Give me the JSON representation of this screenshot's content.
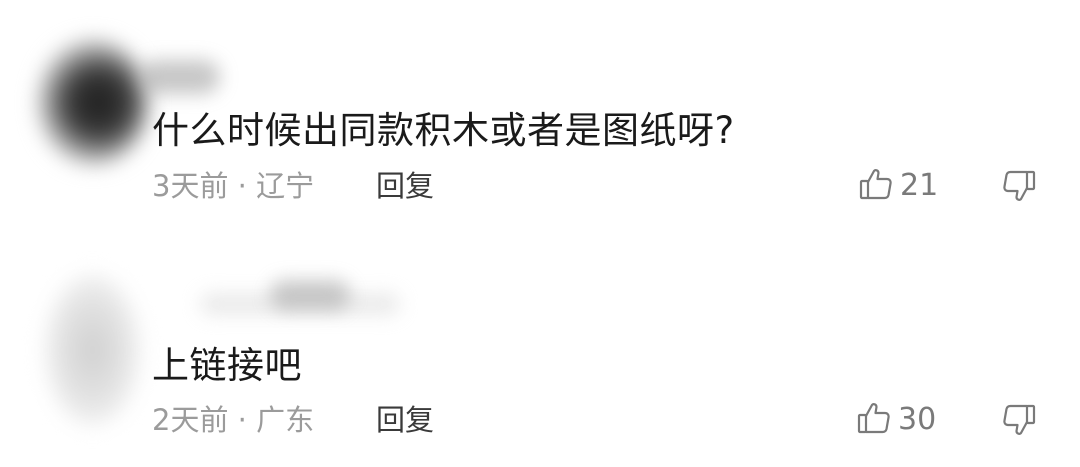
{
  "comments": [
    {
      "text": "什么时候出同款积木或者是图纸呀?",
      "meta": "3天前 · 辽宁",
      "reply_label": "回复",
      "likes": "21"
    },
    {
      "text": "上链接吧",
      "meta": "2天前 · 广东",
      "reply_label": "回复",
      "likes": "30"
    }
  ],
  "icons": {
    "like": "thumbs-up-icon",
    "dislike": "thumbs-down-icon"
  },
  "colors": {
    "text": "#1a1a1a",
    "meta": "#9b9b9b",
    "reply": "#3a3a3a",
    "icon": "#7a7a7a",
    "background": "#ffffff"
  }
}
